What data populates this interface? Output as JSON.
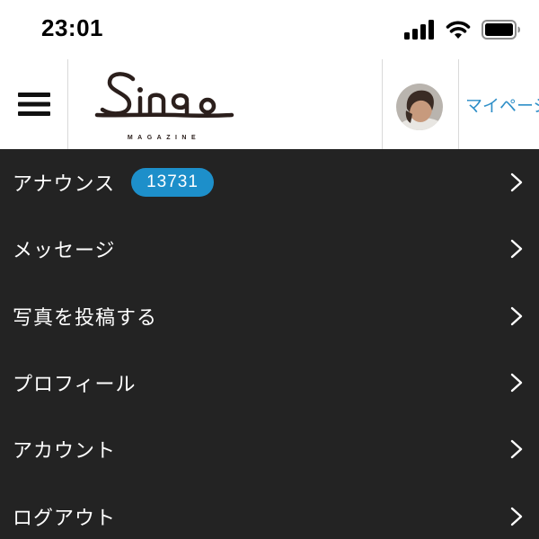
{
  "status_bar": {
    "time": "23:01",
    "icons": [
      "cellular-signal-icon",
      "wifi-icon",
      "battery-icon"
    ]
  },
  "header": {
    "logo_text": "Sinq",
    "logo_subtext": "MAGAZINE",
    "mypage_label": "マイページ",
    "icons": [
      "hamburger-menu-icon"
    ]
  },
  "menu": {
    "items": [
      {
        "label": "アナウンス",
        "badge": "13731"
      },
      {
        "label": "メッセージ"
      },
      {
        "label": "写真を投稿する"
      },
      {
        "label": "プロフィール"
      },
      {
        "label": "アカウント"
      },
      {
        "label": "ログアウト"
      }
    ],
    "chevron_icon": "chevron-right-icon"
  },
  "colors": {
    "accent": "#1d8fca",
    "link": "#2f8fc8",
    "menu_background": "#232323",
    "logo": "#2b1f1c"
  }
}
